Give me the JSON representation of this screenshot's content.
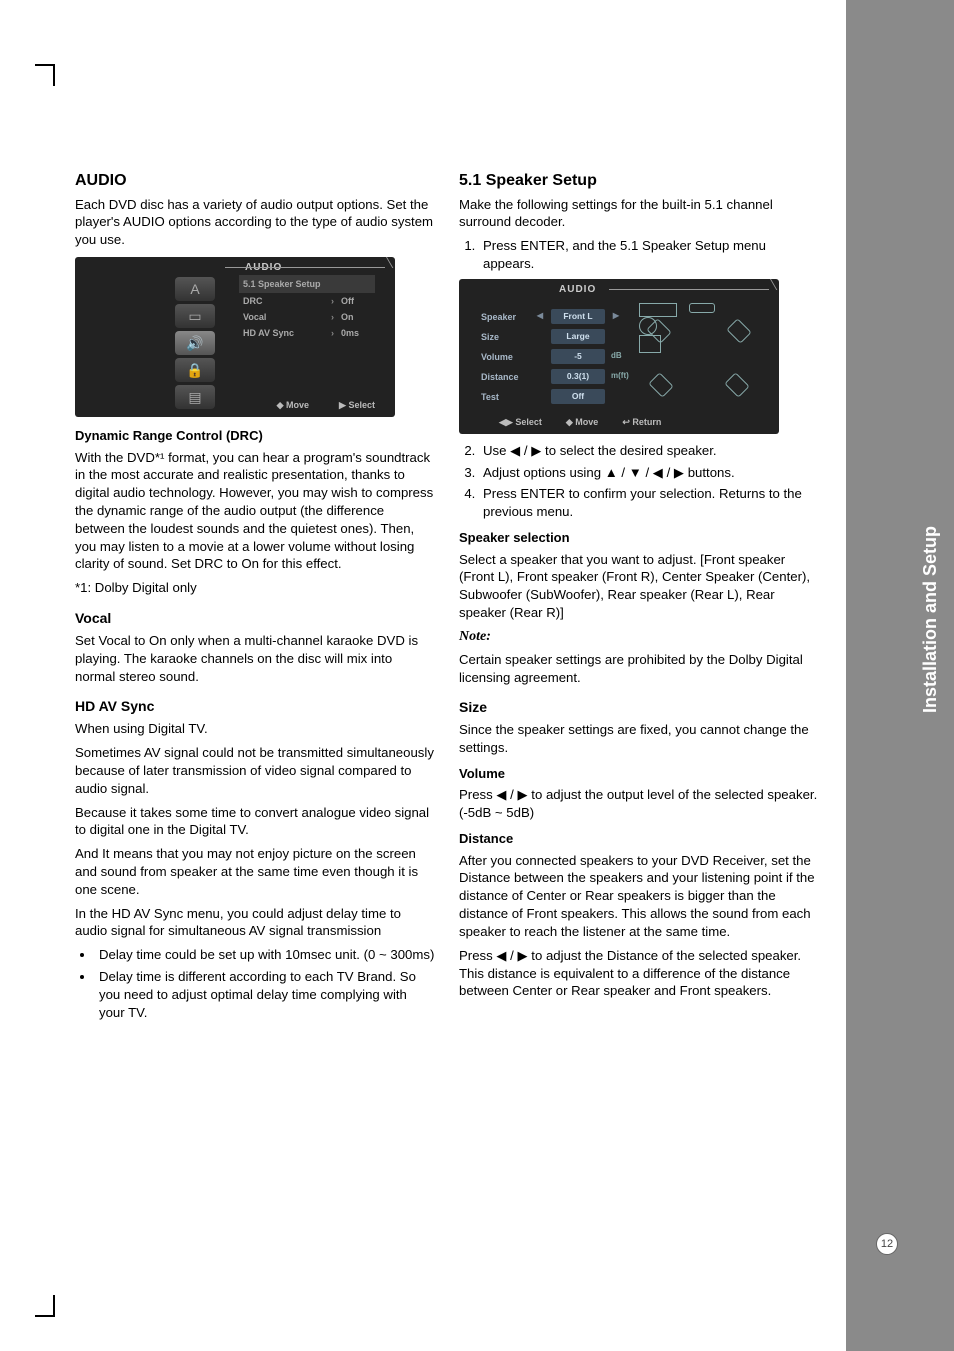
{
  "sidetab": {
    "label": "Installation and Setup"
  },
  "page_number": "12",
  "left": {
    "h2": "AUDIO",
    "intro": "Each DVD disc has a variety of audio output options. Set the player's AUDIO options according to the type of audio system you use.",
    "menu": {
      "title": "AUDIO",
      "items": [
        {
          "label": "5.1 Speaker Setup",
          "value": ""
        },
        {
          "label": "DRC",
          "value": "Off"
        },
        {
          "label": "Vocal",
          "value": "On"
        },
        {
          "label": "HD AV Sync",
          "value": "0ms"
        }
      ],
      "footer_move": "Move",
      "footer_select": "Select"
    },
    "drc_h": "Dynamic Range Control (DRC)",
    "drc_p": "With the DVD*¹ format, you can hear a program's soundtrack in the most accurate and realistic presentation, thanks to digital audio technology. However, you may wish to compress the dynamic range of the audio output (the difference between the loudest sounds and the quietest ones). Then, you may listen to a movie at a lower volume without losing clarity of sound. Set DRC to On for this effect.",
    "drc_note": "*1: Dolby Digital only",
    "vocal_h": "Vocal",
    "vocal_p": "Set Vocal to On only when a multi-channel karaoke DVD is playing. The karaoke channels on the disc will mix into normal stereo sound.",
    "sync_h": "HD AV Sync",
    "sync_p1": "When using Digital TV.",
    "sync_p2": "Sometimes AV signal could not be transmitted simultaneously because of later transmission of video signal compared to audio signal.",
    "sync_p3": "Because it takes some time to convert analogue video signal to digital one in the Digital TV.",
    "sync_p4": "And It means that you may not enjoy picture on the screen and sound from speaker at the same time even though it is one scene.",
    "sync_p5": "In the HD AV Sync menu, you could adjust delay time to audio signal for simultaneous AV signal transmission",
    "sync_b1": "Delay time could be set up with 10msec unit. (0 ~ 300ms)",
    "sync_b2": "Delay time is different according to each TV Brand. So you need to adjust optimal delay time complying with your TV."
  },
  "right": {
    "h2": "5.1 Speaker Setup",
    "intro": "Make the following settings for the built-in 5.1 channel surround decoder.",
    "step1": "Press ENTER, and the 5.1 Speaker Setup menu appears.",
    "menu": {
      "title": "AUDIO",
      "fields": {
        "speaker_lbl": "Speaker",
        "speaker_val": "Front L",
        "size_lbl": "Size",
        "size_val": "Large",
        "volume_lbl": "Volume",
        "volume_val": "-5",
        "volume_unit": "dB",
        "distance_lbl": "Distance",
        "distance_val": "0.3(1)",
        "distance_unit": "m(ft)",
        "test_lbl": "Test",
        "test_val": "Off"
      },
      "footer_select": "Select",
      "footer_move": "Move",
      "footer_return": "Return"
    },
    "step2": "Use ◀ / ▶ to select the desired speaker.",
    "step3": "Adjust options using ▲ / ▼ / ◀ / ▶ buttons.",
    "step4": "Press ENTER to confirm your selection. Returns to the previous menu.",
    "spksel_h": "Speaker selection",
    "spksel_p": "Select a speaker that you want to adjust. [Front speaker (Front L), Front speaker (Front R), Center Speaker (Center), Subwoofer (SubWoofer), Rear speaker (Rear L), Rear speaker (Rear R)]",
    "note_h": "Note:",
    "note_p": "Certain speaker settings are prohibited by the Dolby Digital licensing agreement.",
    "size_h": "Size",
    "size_p": "Since the speaker settings are fixed, you cannot change the settings.",
    "vol_h": "Volume",
    "vol_p": "Press ◀ / ▶ to adjust the output level of the selected speaker. (-5dB ~ 5dB)",
    "dist_h": "Distance",
    "dist_p": "After you connected speakers to your DVD Receiver, set the Distance between the speakers and your listening point if the distance of Center or Rear speakers is bigger than the distance of Front speakers. This allows the sound from each speaker to reach the listener at the same time.",
    "dist_p2": "Press ◀ / ▶ to adjust the Distance of the selected speaker. This distance is equivalent to a difference of the distance between Center or Rear speaker and Front speakers."
  }
}
